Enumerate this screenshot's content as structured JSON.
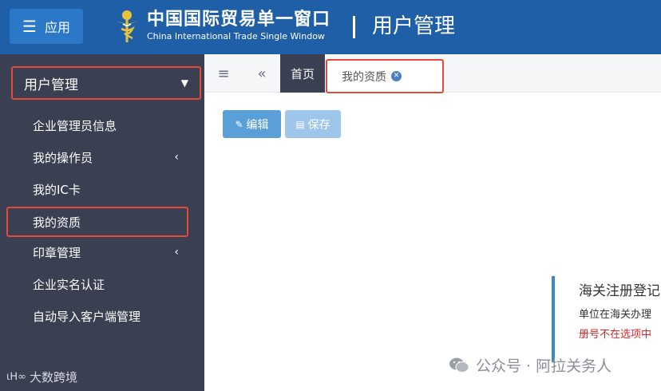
{
  "header": {
    "app_button_label": "应用",
    "brand_cn": "中国国际贸易单一窗口",
    "brand_en": "China International Trade Single Window",
    "page_title": "用户管理"
  },
  "sidebar": {
    "section_title": "用户管理",
    "items": [
      {
        "label": "企业管理员信息",
        "has_arrow": false
      },
      {
        "label": "我的操作员",
        "has_arrow": true
      },
      {
        "label": "我的IC卡",
        "has_arrow": false
      },
      {
        "label": "我的资质",
        "has_arrow": false,
        "highlighted": true
      },
      {
        "label": "印章管理",
        "has_arrow": true
      },
      {
        "label": "企业实名认证",
        "has_arrow": false
      },
      {
        "label": "自动导入客户端管理",
        "has_arrow": false
      }
    ]
  },
  "tabs": {
    "home_label": "首页",
    "active_label": "我的资质"
  },
  "toolbar": {
    "edit_label": "编辑",
    "save_label": "保存"
  },
  "notice": {
    "title": "海关注册登记",
    "line1": "单位在海关办理",
    "line2": "册号不在选项中"
  },
  "watermarks": {
    "left": "大数跨境",
    "right": "公众号 · 阿拉关务人"
  },
  "colors": {
    "header_bg": "#1f5fa8",
    "sidebar_bg": "#3a3f51",
    "highlight_border": "#e24b3b",
    "edit_button": "#5b9fd9",
    "save_button": "#9ec6ea",
    "notice_red": "#d8262a"
  }
}
